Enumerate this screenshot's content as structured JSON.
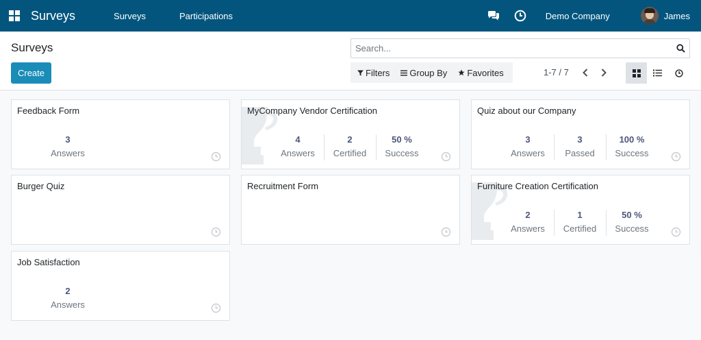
{
  "navbar": {
    "app_name": "Surveys",
    "menu": [
      "Surveys",
      "Participations"
    ],
    "company": "Demo Company",
    "user": "James"
  },
  "control_panel": {
    "title": "Surveys",
    "create_label": "Create",
    "search_placeholder": "Search...",
    "filters_label": "Filters",
    "groupby_label": "Group By",
    "favorites_label": "Favorites",
    "pager": "1-7 / 7"
  },
  "cards": [
    {
      "title": "Feedback Form",
      "stats": [
        {
          "value": "3",
          "label": "Answers"
        }
      ]
    },
    {
      "title": "MyCompany Vendor Certification",
      "stats": [
        {
          "value": "4",
          "label": "Answers"
        },
        {
          "value": "2",
          "label": "Certified"
        },
        {
          "value": "50 %",
          "label": "Success"
        }
      ]
    },
    {
      "title": "Quiz about our Company",
      "stats": [
        {
          "value": "3",
          "label": "Answers"
        },
        {
          "value": "3",
          "label": "Passed"
        },
        {
          "value": "100 %",
          "label": "Success"
        }
      ]
    },
    {
      "title": "Burger Quiz",
      "stats": []
    },
    {
      "title": "Recruitment Form",
      "stats": []
    },
    {
      "title": "Furniture Creation Certification",
      "stats": [
        {
          "value": "2",
          "label": "Answers"
        },
        {
          "value": "1",
          "label": "Certified"
        },
        {
          "value": "50 %",
          "label": "Success"
        }
      ]
    },
    {
      "title": "Job Satisfaction",
      "stats": [
        {
          "value": "2",
          "label": "Answers"
        }
      ]
    }
  ],
  "colors": {
    "navbar": "#03557e",
    "primary_button": "#1a8cb8",
    "stat_value": "#4b567c"
  }
}
